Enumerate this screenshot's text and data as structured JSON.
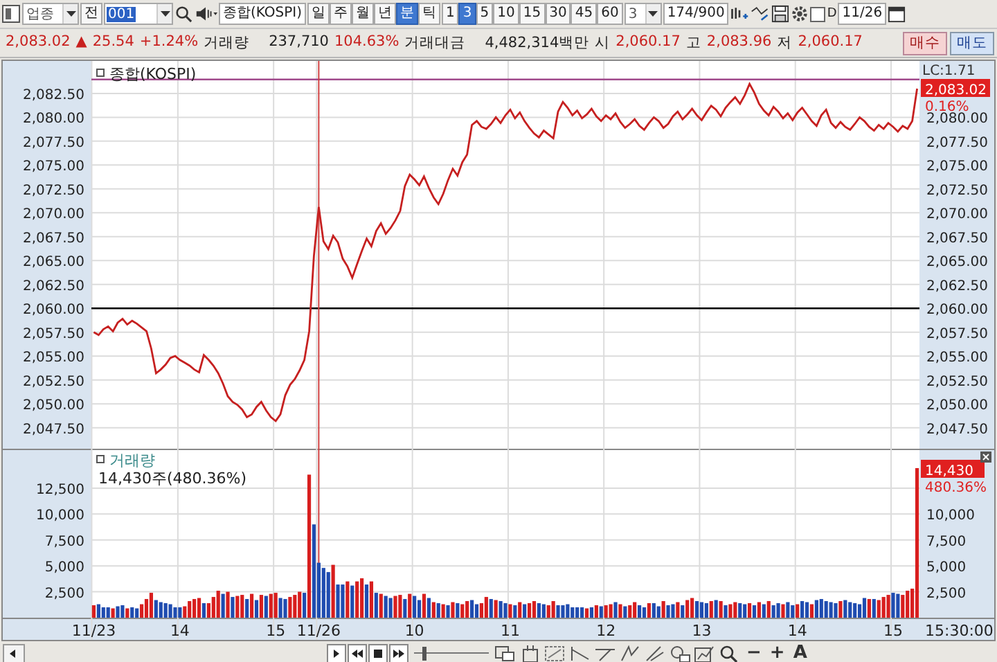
{
  "toolbar": {
    "market": "업종",
    "market_button": "전",
    "code": "001",
    "name": "종합(KOSPI)",
    "periods": [
      {
        "label": "일",
        "selected": false
      },
      {
        "label": "주",
        "selected": false
      },
      {
        "label": "월",
        "selected": false
      },
      {
        "label": "년",
        "selected": false
      },
      {
        "label": "분",
        "selected": true
      },
      {
        "label": "틱",
        "selected": false
      }
    ],
    "intervals": [
      {
        "label": "1",
        "selected": false
      },
      {
        "label": "3",
        "selected": true
      },
      {
        "label": "5",
        "selected": false
      },
      {
        "label": "10",
        "selected": false
      },
      {
        "label": "15",
        "selected": false
      },
      {
        "label": "30",
        "selected": false
      },
      {
        "label": "45",
        "selected": false
      },
      {
        "label": "60",
        "selected": false
      }
    ],
    "interval_value": "3",
    "count": "174/900",
    "d_checked": false,
    "d_label": "D",
    "date": "11/26"
  },
  "quote": [
    {
      "text": "2,083.02",
      "kind": "up"
    },
    {
      "text": "▲",
      "kind": "up"
    },
    {
      "text": "25.54",
      "kind": "up"
    },
    {
      "text": "+1.24%",
      "kind": "up"
    },
    {
      "text": "거래량",
      "kind": "label"
    },
    {
      "text": "237,710",
      "kind": "wide"
    },
    {
      "text": "104.63%",
      "kind": "up"
    },
    {
      "text": "거래대금",
      "kind": "label"
    },
    {
      "text": "4,482,314백만",
      "kind": "wide"
    },
    {
      "text": "시",
      "kind": "label"
    },
    {
      "text": "2,060.17",
      "kind": "up"
    },
    {
      "text": "고",
      "kind": "label"
    },
    {
      "text": "2,083.96",
      "kind": "up"
    },
    {
      "text": "저",
      "kind": "label"
    },
    {
      "text": "2,060.17",
      "kind": "up"
    }
  ],
  "order_buttons": [
    {
      "label": "매수",
      "kind": "buy"
    },
    {
      "label": "매도",
      "kind": "sell"
    }
  ],
  "price_chart": {
    "indicator": "LC:1.71",
    "last_label": "2,083.02",
    "last_note": "0.16%",
    "chart_data": {
      "type": "line",
      "title": "종합(KOSPI)",
      "grid": true,
      "ylim": [
        2045.3,
        2085.9
      ],
      "yticks": [
        {
          "value": 2082.5,
          "label": "2,082.50"
        },
        {
          "value": 2080,
          "label": "2,080.00"
        },
        {
          "value": 2077.5,
          "label": "2,077.50"
        },
        {
          "value": 2075,
          "label": "2,075.00"
        },
        {
          "value": 2072.5,
          "label": "2,072.50"
        },
        {
          "value": 2070,
          "label": "2,070.00"
        },
        {
          "value": 2067.5,
          "label": "2,067.50"
        },
        {
          "value": 2065,
          "label": "2,065.00"
        },
        {
          "value": 2062.5,
          "label": "2,062.50"
        },
        {
          "value": 2060,
          "label": "2,060.00"
        },
        {
          "value": 2057.5,
          "label": "2,057.50"
        },
        {
          "value": 2055,
          "label": "2,055.00"
        },
        {
          "value": 2052.5,
          "label": "2,052.50"
        },
        {
          "value": 2050,
          "label": "2,050.00"
        },
        {
          "value": 2047.5,
          "label": "2,047.50"
        }
      ],
      "ref_lines": [
        {
          "axis": "y",
          "value": 2083.96,
          "color": "#a04a8c"
        },
        {
          "axis": "y",
          "value": 2060.0,
          "color": "#000000"
        }
      ],
      "series": [
        {
          "color": "#c62020",
          "values": [
            2057.5,
            2057.2,
            2057.8,
            2058.1,
            2057.6,
            2058.5,
            2058.9,
            2058.3,
            2058.7,
            2058.4,
            2058.0,
            2057.6,
            2055.8,
            2053.2,
            2053.6,
            2054.1,
            2054.8,
            2055.0,
            2054.6,
            2054.3,
            2054.0,
            2053.6,
            2053.3,
            2055.1,
            2054.6,
            2054.0,
            2053.2,
            2052.1,
            2050.8,
            2050.2,
            2049.9,
            2049.4,
            2048.6,
            2048.9,
            2049.7,
            2050.2,
            2049.3,
            2048.6,
            2048.2,
            2048.9,
            2050.9,
            2052.0,
            2052.6,
            2053.5,
            2054.6,
            2057.6,
            2065.5,
            2070.6,
            2067.0,
            2066.2,
            2067.6,
            2066.9,
            2065.2,
            2064.4,
            2063.2,
            2064.6,
            2066.0,
            2067.3,
            2066.5,
            2068.1,
            2068.9,
            2067.8,
            2068.4,
            2069.2,
            2070.2,
            2072.8,
            2074.0,
            2073.5,
            2072.9,
            2073.8,
            2072.6,
            2071.6,
            2070.9,
            2072.0,
            2073.4,
            2074.6,
            2073.9,
            2075.3,
            2076.1,
            2079.2,
            2079.6,
            2079.0,
            2078.8,
            2079.3,
            2080.0,
            2079.4,
            2080.2,
            2080.8,
            2079.9,
            2080.5,
            2079.6,
            2078.9,
            2078.3,
            2077.9,
            2078.6,
            2078.2,
            2077.8,
            2080.6,
            2081.6,
            2081.0,
            2080.2,
            2080.7,
            2079.9,
            2080.3,
            2080.9,
            2080.1,
            2079.6,
            2080.2,
            2079.8,
            2080.4,
            2079.5,
            2078.9,
            2079.3,
            2079.8,
            2079.1,
            2078.7,
            2079.4,
            2080.0,
            2079.6,
            2078.9,
            2079.3,
            2080.1,
            2080.6,
            2079.8,
            2080.3,
            2080.9,
            2080.2,
            2079.7,
            2080.5,
            2081.2,
            2080.8,
            2080.1,
            2081.0,
            2081.6,
            2082.1,
            2081.4,
            2082.3,
            2083.5,
            2082.6,
            2081.4,
            2080.7,
            2080.2,
            2081.1,
            2080.6,
            2079.9,
            2080.4,
            2079.7,
            2080.5,
            2081.0,
            2080.3,
            2079.6,
            2079.1,
            2080.2,
            2080.8,
            2079.4,
            2078.9,
            2079.5,
            2079.0,
            2078.7,
            2079.3,
            2080.0,
            2079.6,
            2079.0,
            2078.6,
            2079.2,
            2078.8,
            2079.4,
            2079.0,
            2078.5,
            2079.1,
            2078.8,
            2079.6,
            2083.0
          ]
        }
      ]
    }
  },
  "volume_chart": {
    "info": "14,430주(480.36%)",
    "last_label": "14,430",
    "last_note": "480.36%",
    "chart_data": {
      "type": "bar",
      "title": "거래량",
      "grid": true,
      "stacked": true,
      "ylim": [
        0,
        16300
      ],
      "categories": [
        "11/23",
        null,
        null,
        null,
        null,
        null,
        null,
        null,
        null,
        null,
        null,
        null,
        null,
        null,
        null,
        null,
        null,
        null,
        "14",
        null,
        null,
        null,
        null,
        null,
        null,
        null,
        null,
        null,
        null,
        null,
        null,
        null,
        null,
        null,
        null,
        null,
        null,
        null,
        "15",
        null,
        null,
        null,
        null,
        null,
        null,
        null,
        null,
        "11/26",
        null,
        null,
        null,
        null,
        null,
        null,
        null,
        null,
        null,
        null,
        null,
        null,
        null,
        null,
        null,
        null,
        null,
        null,
        null,
        "10",
        null,
        null,
        null,
        null,
        null,
        null,
        null,
        null,
        null,
        null,
        null,
        null,
        null,
        null,
        null,
        null,
        null,
        null,
        null,
        "11",
        null,
        null,
        null,
        null,
        null,
        null,
        null,
        null,
        null,
        null,
        null,
        null,
        null,
        null,
        null,
        null,
        null,
        null,
        null,
        "12",
        null,
        null,
        null,
        null,
        null,
        null,
        null,
        null,
        null,
        null,
        null,
        null,
        null,
        null,
        null,
        null,
        null,
        null,
        null,
        "13",
        null,
        null,
        null,
        null,
        null,
        null,
        null,
        null,
        null,
        null,
        null,
        null,
        null,
        null,
        null,
        null,
        null,
        null,
        null,
        "14",
        null,
        null,
        null,
        null,
        null,
        null,
        null,
        null,
        null,
        null,
        null,
        null,
        null,
        null,
        null,
        null,
        null,
        null,
        null,
        "15",
        null,
        null,
        null,
        null,
        null
      ],
      "yticks": [
        {
          "value": 12500,
          "label": "12,500"
        },
        {
          "value": 10000,
          "label": "10,000"
        },
        {
          "value": 7500,
          "label": "7,500"
        },
        {
          "value": 5000,
          "label": "5,000"
        },
        {
          "value": 2500,
          "label": "2,500"
        }
      ],
      "ref_lines": [
        {
          "axis": "x",
          "value": "11/26",
          "color": "#d04040"
        }
      ],
      "series": [
        {
          "color": "#d81e1e",
          "values": [
            1200,
            null,
            null,
            null,
            900,
            null,
            null,
            900,
            null,
            null,
            1300,
            1800,
            2400,
            null,
            null,
            null,
            null,
            null,
            null,
            1100,
            1600,
            1800,
            1900,
            null,
            1400,
            2000,
            2600,
            null,
            2500,
            null,
            2100,
            2200,
            null,
            2300,
            null,
            2200,
            null,
            2300,
            2400,
            null,
            null,
            2000,
            2200,
            2500,
            null,
            13800,
            null,
            null,
            null,
            null,
            5100,
            null,
            null,
            3500,
            null,
            3500,
            3800,
            null,
            3500,
            null,
            2300,
            null,
            null,
            2100,
            2200,
            null,
            2300,
            null,
            null,
            2300,
            null,
            1500,
            null,
            1300,
            null,
            1500,
            null,
            1300,
            1600,
            null,
            null,
            1400,
            2000,
            null,
            1700,
            null,
            null,
            1300,
            null,
            1500,
            null,
            1400,
            1600,
            null,
            null,
            1200,
            1600,
            null,
            null,
            null,
            null,
            null,
            null,
            900,
            null,
            1200,
            null,
            1200,
            1300,
            null,
            1300,
            null,
            1200,
            1500,
            null,
            null,
            1400,
            null,
            null,
            1600,
            null,
            null,
            1500,
            null,
            1700,
            1900,
            null,
            null,
            null,
            1600,
            null,
            1600,
            null,
            1300,
            1500,
            null,
            null,
            1400,
            null,
            1500,
            null,
            1600,
            null,
            null,
            1300,
            null,
            null,
            1300,
            null,
            null,
            1300,
            null,
            null,
            null,
            null,
            null,
            1600,
            null,
            null,
            null,
            null,
            null,
            1800,
            null,
            1700,
            2000,
            2200,
            null,
            null,
            2200,
            2600,
            2800,
            14430
          ]
        },
        {
          "color": "#1f4cb0",
          "values": [
            null,
            1300,
            1000,
            1000,
            null,
            1100,
            1200,
            null,
            1000,
            900,
            null,
            null,
            null,
            1700,
            1500,
            1400,
            1300,
            1000,
            1000,
            null,
            null,
            null,
            null,
            1400,
            null,
            null,
            null,
            2300,
            null,
            2000,
            null,
            null,
            1800,
            null,
            1700,
            null,
            2100,
            null,
            null,
            1900,
            1800,
            null,
            null,
            null,
            2400,
            null,
            9000,
            5300,
            4800,
            4400,
            null,
            3200,
            3200,
            null,
            3100,
            null,
            null,
            3200,
            null,
            2400,
            null,
            2100,
            1900,
            null,
            null,
            1800,
            null,
            2100,
            1700,
            null,
            1900,
            null,
            1400,
            null,
            1200,
            null,
            1400,
            null,
            null,
            1700,
            1300,
            null,
            null,
            1800,
            null,
            1600,
            1400,
            null,
            1200,
            null,
            1300,
            null,
            null,
            1400,
            1300,
            null,
            null,
            1200,
            1200,
            1300,
            1000,
            1000,
            1000,
            null,
            1000,
            null,
            1100,
            null,
            null,
            1500,
            null,
            1100,
            null,
            null,
            1200,
            1000,
            null,
            1400,
            1100,
            null,
            1200,
            1300,
            null,
            1200,
            null,
            null,
            1600,
            1500,
            1400,
            null,
            1700,
            null,
            1200,
            null,
            null,
            1400,
            1300,
            null,
            1200,
            null,
            1300,
            null,
            1200,
            1400,
            null,
            1500,
            1200,
            null,
            1600,
            1500,
            null,
            1700,
            1800,
            1600,
            1500,
            1400,
            null,
            1700,
            1500,
            1400,
            1300,
            1900,
            null,
            1800,
            null,
            null,
            null,
            2400,
            2300,
            null,
            null,
            null,
            null
          ]
        }
      ]
    }
  },
  "time_label": "15:30:00",
  "speed_slider": {
    "level": 0.15
  },
  "zoom_controls": [
    "−",
    "+",
    "A"
  ]
}
